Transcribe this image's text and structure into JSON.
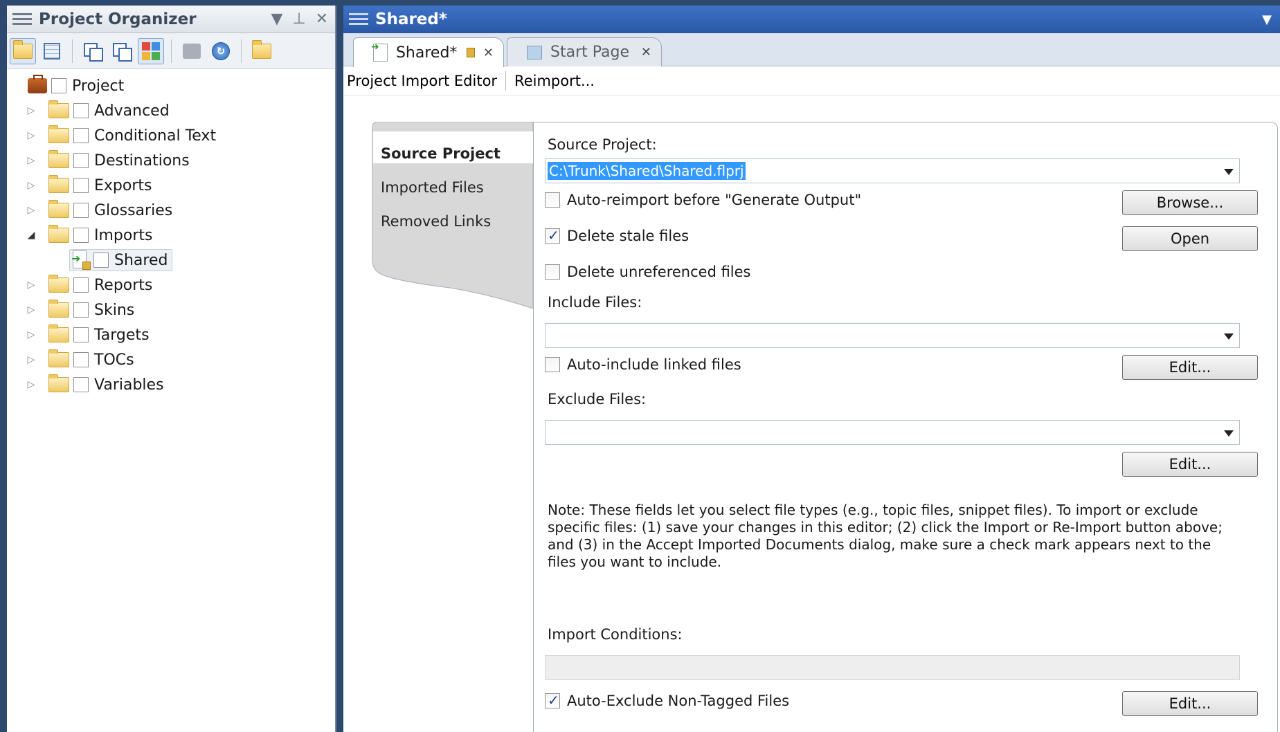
{
  "organizer": {
    "title": "Project Organizer",
    "tree": {
      "root": "Project",
      "items": [
        {
          "label": "Advanced",
          "expanded": false
        },
        {
          "label": "Conditional Text",
          "expanded": false
        },
        {
          "label": "Destinations",
          "expanded": false
        },
        {
          "label": "Exports",
          "expanded": false
        },
        {
          "label": "Glossaries",
          "expanded": false
        },
        {
          "label": "Imports",
          "expanded": true
        },
        {
          "label": "Shared",
          "child": true
        },
        {
          "label": "Reports",
          "expanded": false
        },
        {
          "label": "Skins",
          "expanded": false
        },
        {
          "label": "Targets",
          "expanded": false
        },
        {
          "label": "TOCs",
          "expanded": false
        },
        {
          "label": "Variables",
          "expanded": false
        }
      ]
    }
  },
  "document": {
    "title": "Shared*",
    "tabs": [
      {
        "label": "Shared*",
        "active": true
      },
      {
        "label": "Start Page",
        "active": false
      }
    ],
    "toolbar": {
      "editor_label": "Project Import Editor",
      "reimport_label": "Reimport..."
    },
    "side_tabs": [
      "Source Project",
      "Imported Files",
      "Removed Links"
    ]
  },
  "form": {
    "source_project_label": "Source Project:",
    "source_project_value": "C:\\Trunk\\Shared\\Shared.flprj",
    "auto_reimport_label": "Auto-reimport before \"Generate Output\"",
    "auto_reimport_checked": false,
    "delete_stale_label": "Delete stale files",
    "delete_stale_checked": true,
    "delete_unref_label": "Delete unreferenced files",
    "delete_unref_checked": false,
    "browse_label": "Browse...",
    "open_label": "Open",
    "include_files_label": "Include Files:",
    "include_files_value": "",
    "auto_include_label": "Auto-include linked files",
    "auto_include_checked": false,
    "edit_include_label": "Edit...",
    "exclude_files_label": "Exclude Files:",
    "exclude_files_value": "",
    "edit_exclude_label": "Edit...",
    "note": "Note: These fields let you select file types (e.g., topic files, snippet files). To import or exclude specific files: (1) save your changes in this editor; (2) click the Import or Re-Import button above; and (3) in the Accept Imported Documents dialog, make sure a check mark appears next to the files you want to include.",
    "import_conditions_label": "Import Conditions:",
    "import_conditions_value": "",
    "auto_exclude_label": "Auto-Exclude Non-Tagged Files",
    "auto_exclude_checked": true,
    "edit_conditions_label": "Edit..."
  },
  "colors": {
    "title_bar_active": "#2a58a6",
    "selection": "#3399ff",
    "folder": "#f0c962"
  }
}
